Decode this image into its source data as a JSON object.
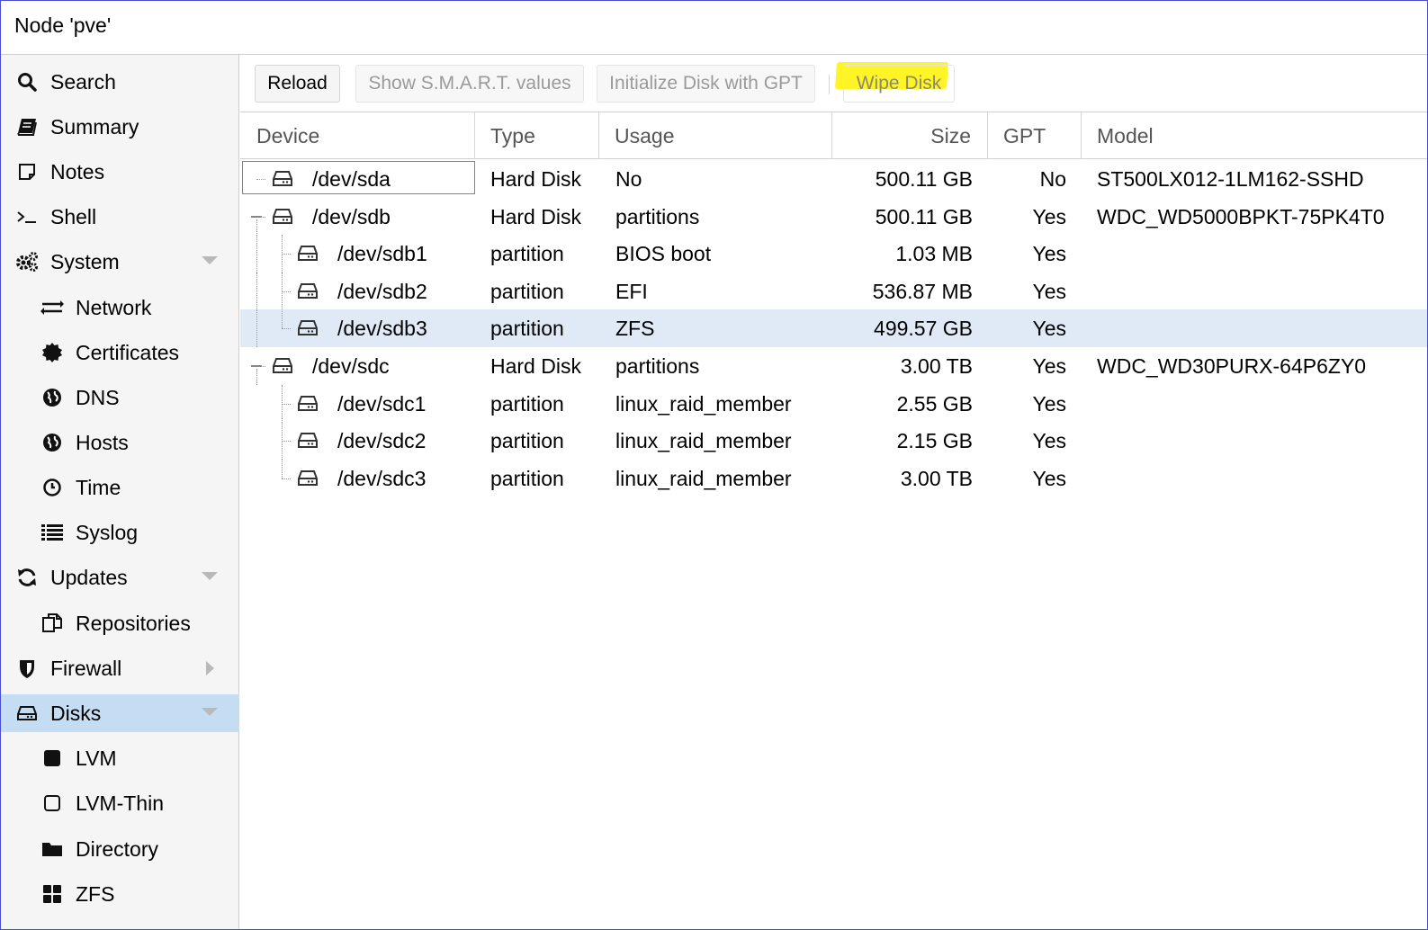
{
  "window": {
    "title": "Node 'pve'"
  },
  "sidebar": {
    "items": [
      {
        "label": "Search",
        "icon": "search-icon",
        "level": 1
      },
      {
        "label": "Summary",
        "icon": "book-icon",
        "level": 1
      },
      {
        "label": "Notes",
        "icon": "notes-icon",
        "level": 1
      },
      {
        "label": "Shell",
        "icon": "terminal-icon",
        "level": 1
      },
      {
        "label": "System",
        "icon": "gears-icon",
        "level": 1,
        "expanded": true
      },
      {
        "label": "Network",
        "icon": "exchange-icon",
        "level": 2
      },
      {
        "label": "Certificates",
        "icon": "certificate-icon",
        "level": 2
      },
      {
        "label": "DNS",
        "icon": "globe-icon",
        "level": 2
      },
      {
        "label": "Hosts",
        "icon": "globe-icon",
        "level": 2
      },
      {
        "label": "Time",
        "icon": "clock-icon",
        "level": 2
      },
      {
        "label": "Syslog",
        "icon": "list-icon",
        "level": 2
      },
      {
        "label": "Updates",
        "icon": "refresh-icon",
        "level": 1,
        "expanded": true
      },
      {
        "label": "Repositories",
        "icon": "copy-icon",
        "level": 2
      },
      {
        "label": "Firewall",
        "icon": "shield-icon",
        "level": 1,
        "expanded": false
      },
      {
        "label": "Disks",
        "icon": "hdd-icon",
        "level": 1,
        "expanded": true,
        "selected": true
      },
      {
        "label": "LVM",
        "icon": "square-icon",
        "level": 2
      },
      {
        "label": "LVM-Thin",
        "icon": "square-outline-icon",
        "level": 2
      },
      {
        "label": "Directory",
        "icon": "folder-icon",
        "level": 2
      },
      {
        "label": "ZFS",
        "icon": "th-large-icon",
        "level": 2
      }
    ]
  },
  "toolbar": {
    "reload": "Reload",
    "smart": "Show S.M.A.R.T. values",
    "init_gpt": "Initialize Disk with GPT",
    "wipe": "Wipe Disk",
    "highlight_color": "#fff200"
  },
  "grid": {
    "columns": [
      "Device",
      "Type",
      "Usage",
      "Size",
      "GPT",
      "Model"
    ],
    "rows": [
      {
        "device": "/dev/sda",
        "type": "Hard Disk",
        "usage": "No",
        "size": "500.11 GB",
        "gpt": "No",
        "model": "ST500LX012-1LM162-SSHD"
      },
      {
        "device": "/dev/sdb",
        "type": "Hard Disk",
        "usage": "partitions",
        "size": "500.11 GB",
        "gpt": "Yes",
        "model": "WDC_WD5000BPKT-75PK4T0"
      },
      {
        "device": "/dev/sdb1",
        "type": "partition",
        "usage": "BIOS boot",
        "size": "1.03 MB",
        "gpt": "Yes",
        "model": ""
      },
      {
        "device": "/dev/sdb2",
        "type": "partition",
        "usage": "EFI",
        "size": "536.87 MB",
        "gpt": "Yes",
        "model": ""
      },
      {
        "device": "/dev/sdb3",
        "type": "partition",
        "usage": "ZFS",
        "size": "499.57 GB",
        "gpt": "Yes",
        "model": ""
      },
      {
        "device": "/dev/sdc",
        "type": "Hard Disk",
        "usage": "partitions",
        "size": "3.00 TB",
        "gpt": "Yes",
        "model": "WDC_WD30PURX-64P6ZY0"
      },
      {
        "device": "/dev/sdc1",
        "type": "partition",
        "usage": "linux_raid_member",
        "size": "2.55 GB",
        "gpt": "Yes",
        "model": ""
      },
      {
        "device": "/dev/sdc2",
        "type": "partition",
        "usage": "linux_raid_member",
        "size": "2.15 GB",
        "gpt": "Yes",
        "model": ""
      },
      {
        "device": "/dev/sdc3",
        "type": "partition",
        "usage": "linux_raid_member",
        "size": "3.00 TB",
        "gpt": "Yes",
        "model": ""
      }
    ]
  },
  "colors": {
    "selected_nav": "#c5ddf3",
    "selected_row": "#dfeaf6",
    "focus_border": "#4a90d9"
  }
}
